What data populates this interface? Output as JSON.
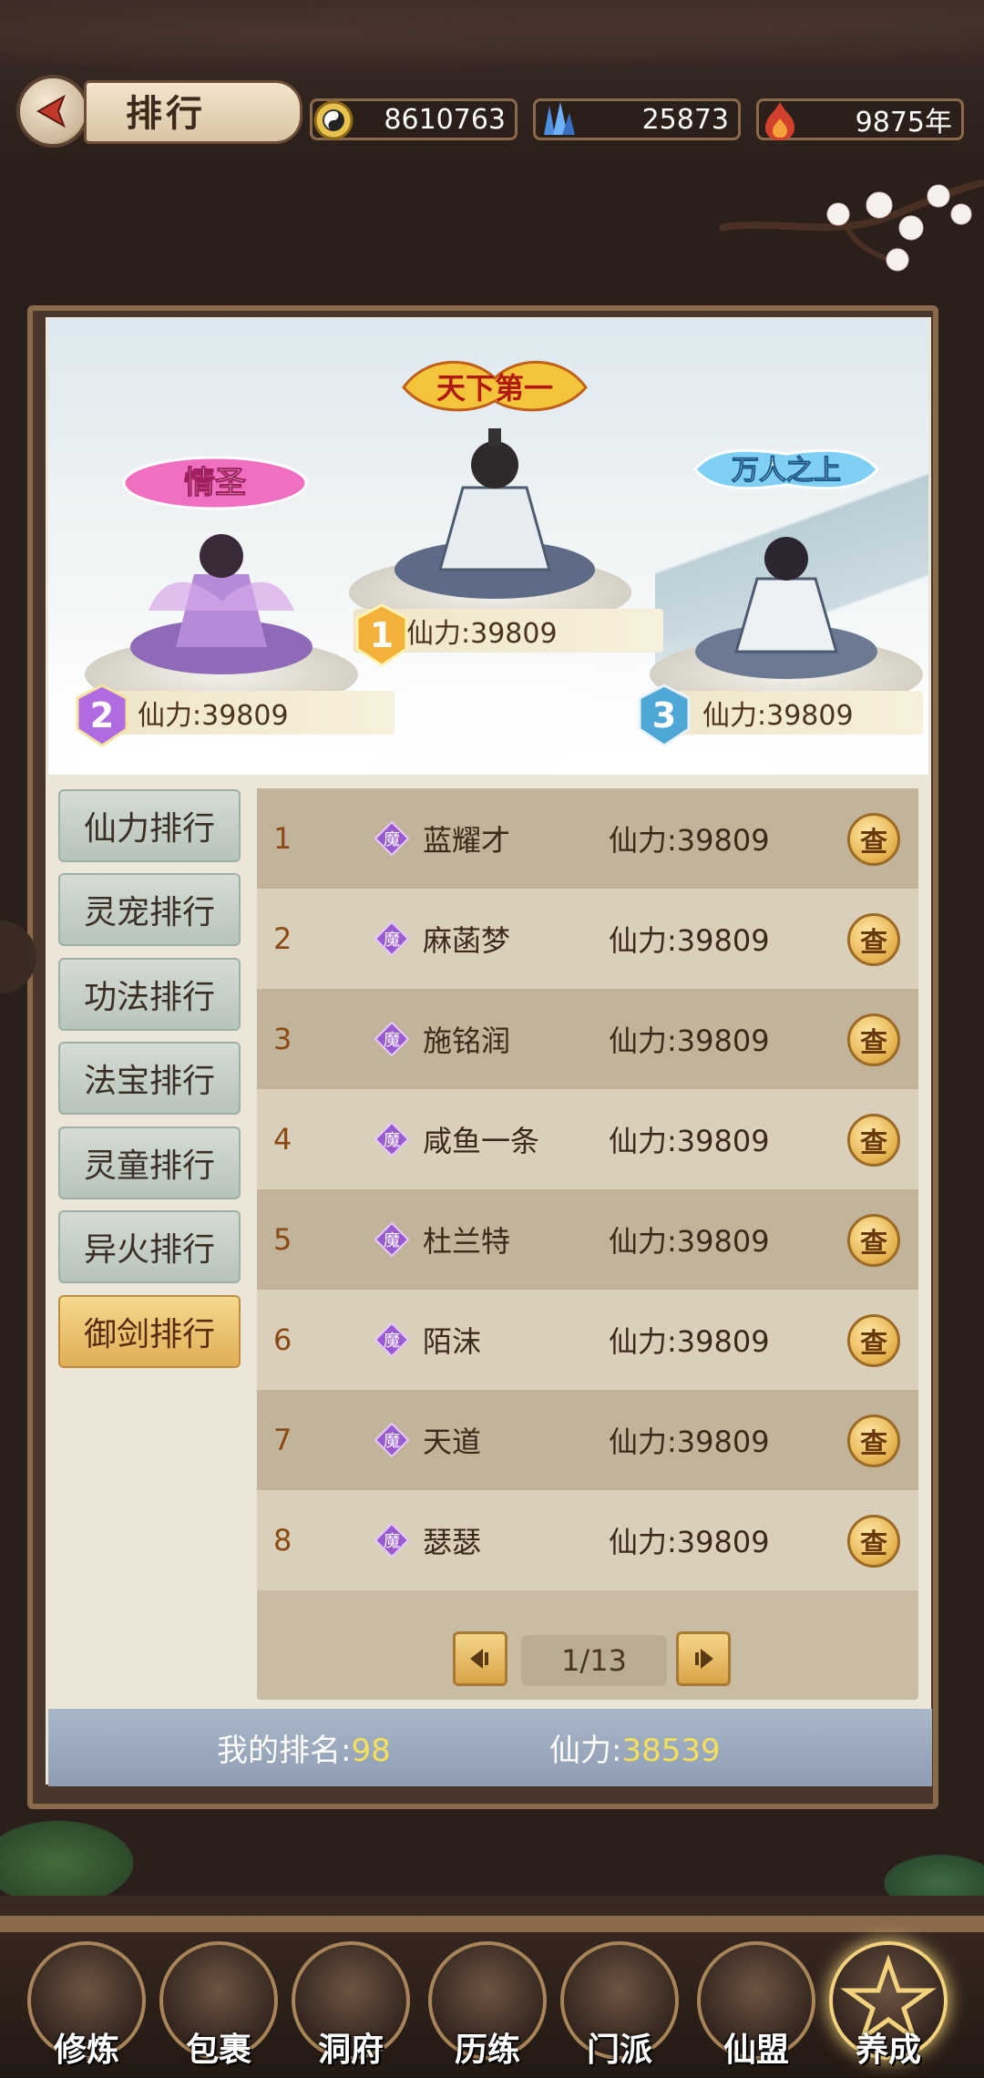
{
  "header": {
    "title": "排行",
    "resources": [
      {
        "icon": "yin-yang-coin-icon",
        "value": "8610763"
      },
      {
        "icon": "blue-crystal-icon",
        "value": "25873"
      },
      {
        "icon": "red-flame-icon",
        "value": "9875年"
      }
    ]
  },
  "podium": [
    {
      "rank": "1",
      "title": "天下第一",
      "power": "仙力:39809"
    },
    {
      "rank": "2",
      "title": "情圣",
      "power": "仙力:39809"
    },
    {
      "rank": "3",
      "title": "万人之上",
      "power": "仙力:39809"
    }
  ],
  "tabs": [
    {
      "label": "仙力排行",
      "active": false
    },
    {
      "label": "灵宠排行",
      "active": false
    },
    {
      "label": "功法排行",
      "active": false
    },
    {
      "label": "法宝排行",
      "active": false
    },
    {
      "label": "灵童排行",
      "active": false
    },
    {
      "label": "异火排行",
      "active": false
    },
    {
      "label": "御剑排行",
      "active": true
    }
  ],
  "ranking": {
    "faction_badge": "魔",
    "view_label": "查",
    "rows": [
      {
        "num": "1",
        "name": "蓝耀才",
        "power": "仙力:39809"
      },
      {
        "num": "2",
        "name": "麻菡梦",
        "power": "仙力:39809"
      },
      {
        "num": "3",
        "name": "施铭润",
        "power": "仙力:39809"
      },
      {
        "num": "4",
        "name": "咸鱼一条",
        "power": "仙力:39809"
      },
      {
        "num": "5",
        "name": "杜兰特",
        "power": "仙力:39809"
      },
      {
        "num": "6",
        "name": "陌沫",
        "power": "仙力:39809"
      },
      {
        "num": "7",
        "name": "天道",
        "power": "仙力:39809"
      },
      {
        "num": "8",
        "name": "瑟瑟",
        "power": "仙力:39809"
      }
    ]
  },
  "pager": {
    "text": "1/13"
  },
  "my_rank": {
    "rank_label": "我的排名:",
    "rank_value": "98",
    "power_label": "仙力:",
    "power_value": "38539"
  },
  "bottom_nav": [
    {
      "label": "修炼",
      "active": false
    },
    {
      "label": "包裹",
      "active": false
    },
    {
      "label": "洞府",
      "active": false
    },
    {
      "label": "历练",
      "active": false
    },
    {
      "label": "门派",
      "active": false
    },
    {
      "label": "仙盟",
      "active": false
    },
    {
      "label": "养成",
      "active": true
    }
  ],
  "colors": {
    "accent_gold": "#e4b04c",
    "active_tab": "#dfae56",
    "highlight_value": "#f5e05a"
  }
}
